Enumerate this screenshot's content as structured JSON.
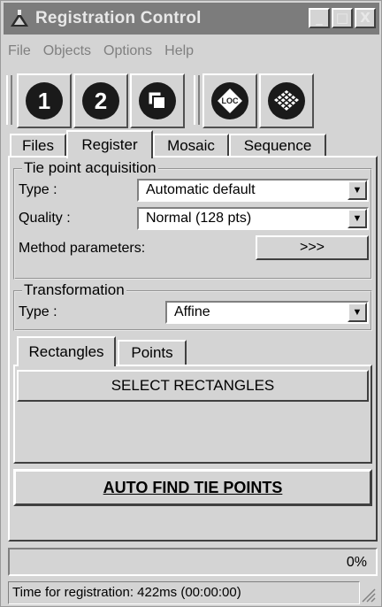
{
  "window": {
    "title": "Registration Control"
  },
  "titlebar_buttons": {
    "minimize": "_",
    "maximize": "□",
    "close": "X"
  },
  "menu": [
    "File",
    "Objects",
    "Options",
    "Help"
  ],
  "toolbar": {
    "buttons": [
      {
        "icon": "step-one-icon",
        "label": "1"
      },
      {
        "icon": "step-two-icon",
        "label": "2"
      },
      {
        "icon": "layers-icon",
        "label": ""
      },
      {
        "icon": "loc-icon",
        "label": "LOC"
      },
      {
        "icon": "grid-icon",
        "label": ""
      }
    ]
  },
  "tabs": [
    "Files",
    "Register",
    "Mosaic",
    "Sequence"
  ],
  "active_tab": "Register",
  "tie_point": {
    "legend": "Tie point acquisition",
    "type_label": "Type :",
    "type_value": "Automatic default",
    "quality_label": "Quality :",
    "quality_value": "Normal (128 pts)",
    "method_label": "Method parameters:",
    "method_button": ">>>"
  },
  "transformation": {
    "legend": "Transformation",
    "type_label": "Type :",
    "type_value": "Affine"
  },
  "subtabs": [
    "Rectangles",
    "Points"
  ],
  "active_subtab": "Rectangles",
  "select_button": "SELECT RECTANGLES",
  "auto_button": "AUTO FIND TIE POINTS",
  "progress": {
    "value": 0,
    "label": "0%"
  },
  "status": "Time for registration: 422ms (00:00:00)",
  "colors": {
    "title_bg": "#7c7c7c",
    "face": "#d4d4d4",
    "icon_dark": "#1a1a1a"
  }
}
